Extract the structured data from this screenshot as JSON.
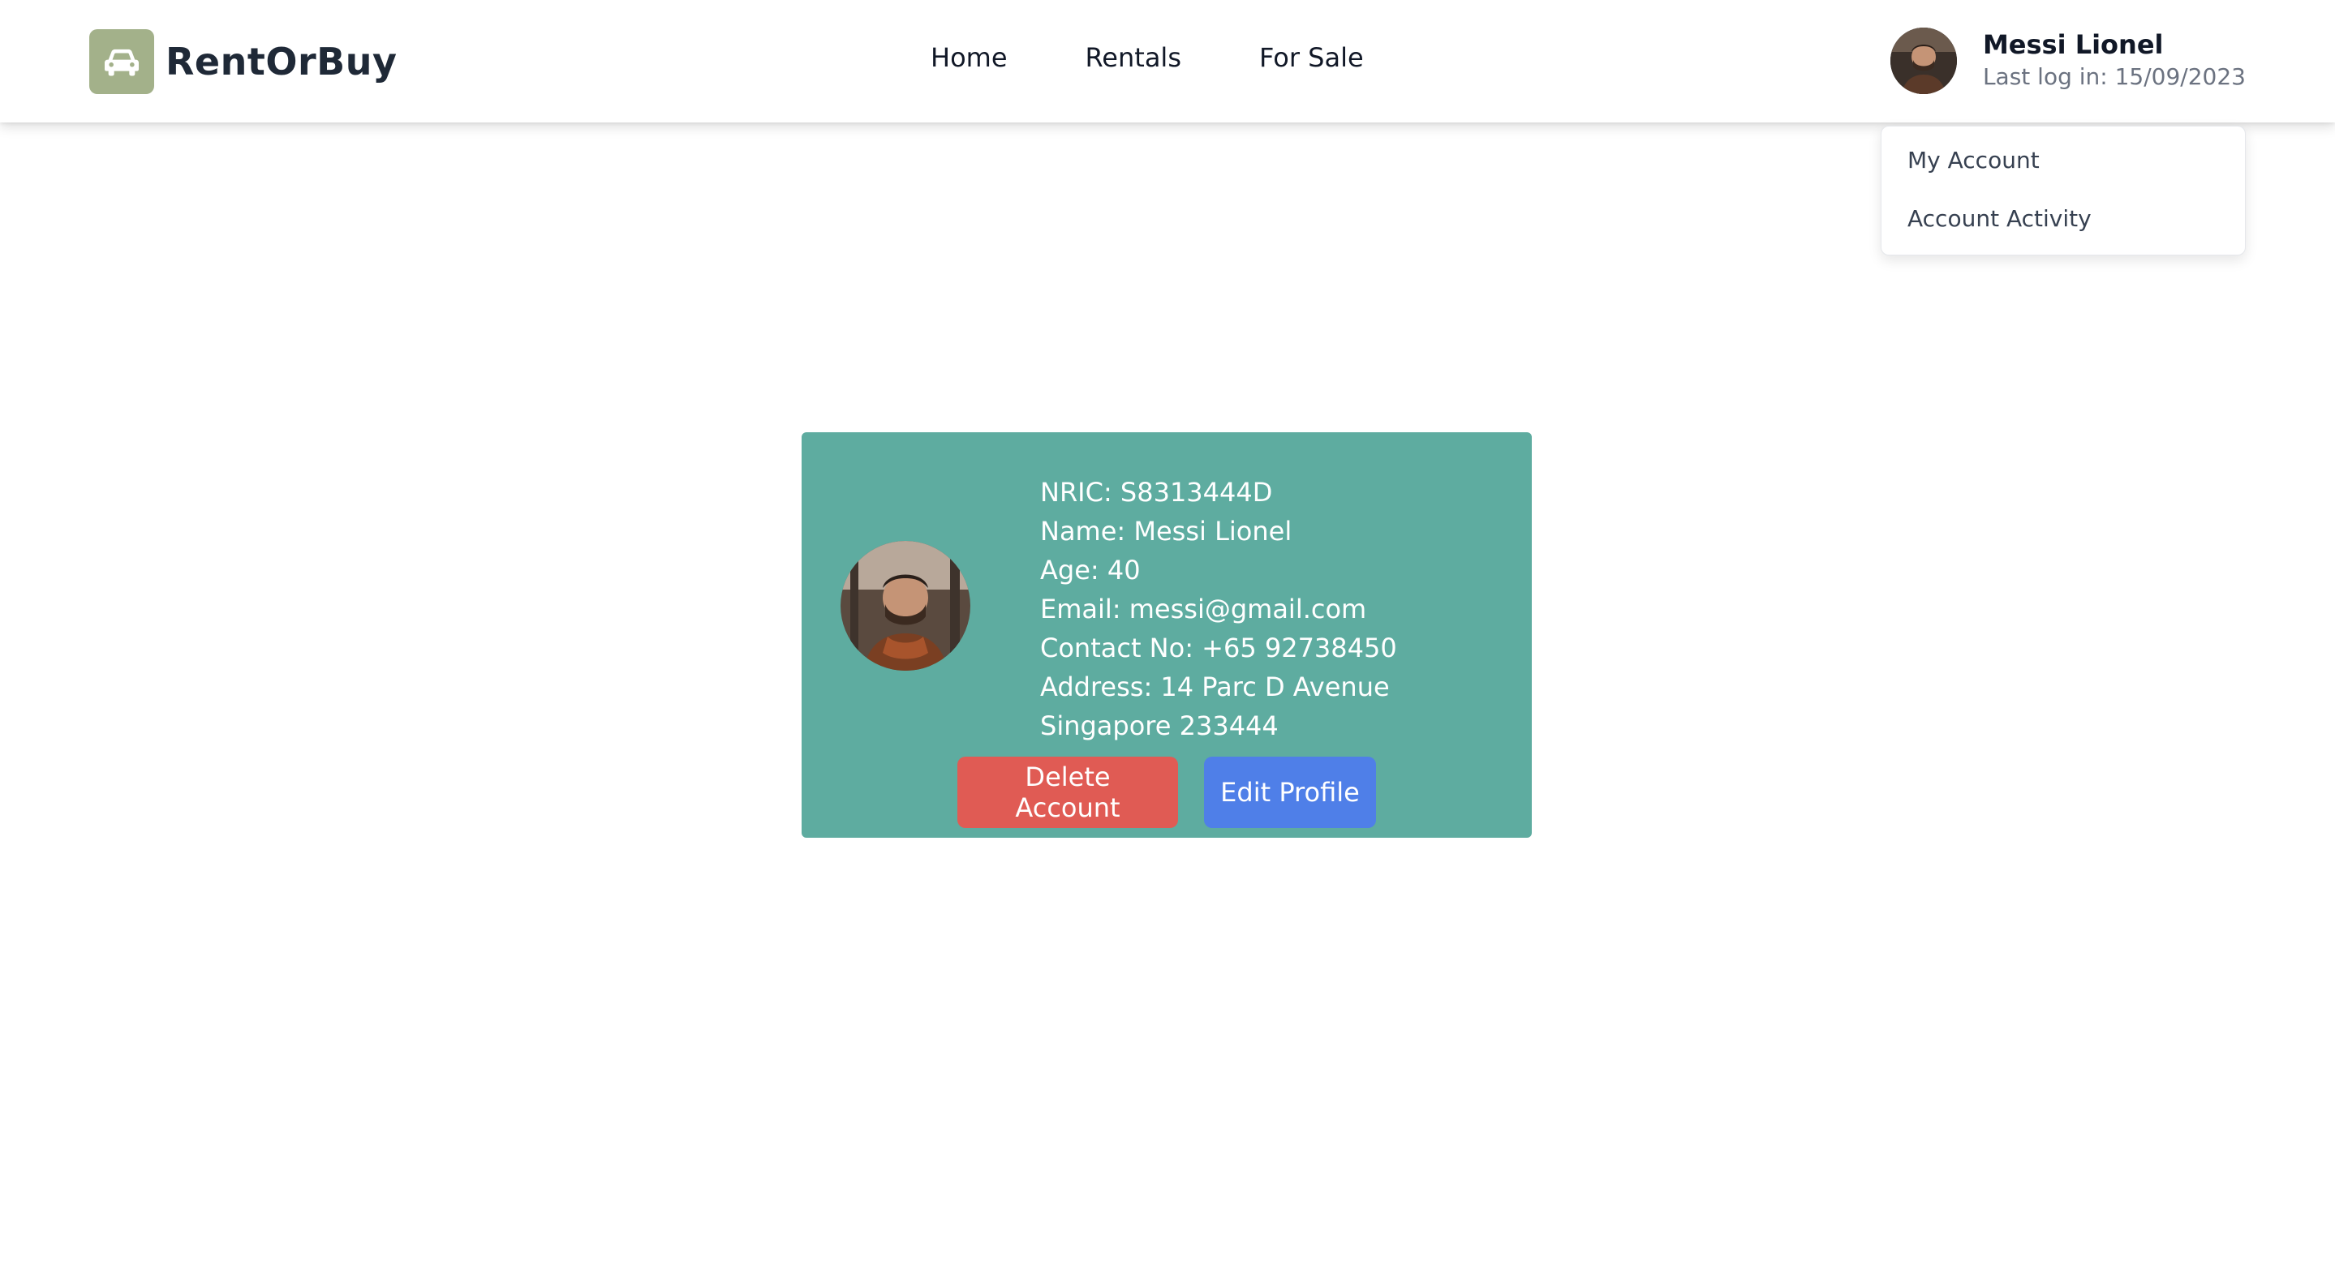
{
  "app": {
    "brand_name": "RentOrBuy",
    "brand_icon": "car-icon",
    "brand_color": "#a3b18a"
  },
  "nav": {
    "items": [
      {
        "label": "Home"
      },
      {
        "label": "Rentals"
      },
      {
        "label": "For Sale"
      }
    ]
  },
  "user": {
    "name": "Messi Lionel",
    "last_login": "Last log in: 15/09/2023"
  },
  "dropdown": {
    "items": [
      {
        "label": "My Account"
      },
      {
        "label": "Account Activity"
      }
    ]
  },
  "profile": {
    "nric": "NRIC: S8313444D",
    "name": "Name: Messi Lionel",
    "age": "Age: 40",
    "email": "Email: messi@gmail.com",
    "contact": "Contact No: +65 92738450",
    "address_line1": "Address: 14 Parc D Avenue",
    "address_line2": "Singapore 233444"
  },
  "actions": {
    "delete_label": "Delete Account",
    "edit_label": "Edit Profile"
  },
  "colors": {
    "card_bg": "#5eaca0",
    "delete_bg": "#e05b54",
    "edit_bg": "#4f7fe8"
  }
}
